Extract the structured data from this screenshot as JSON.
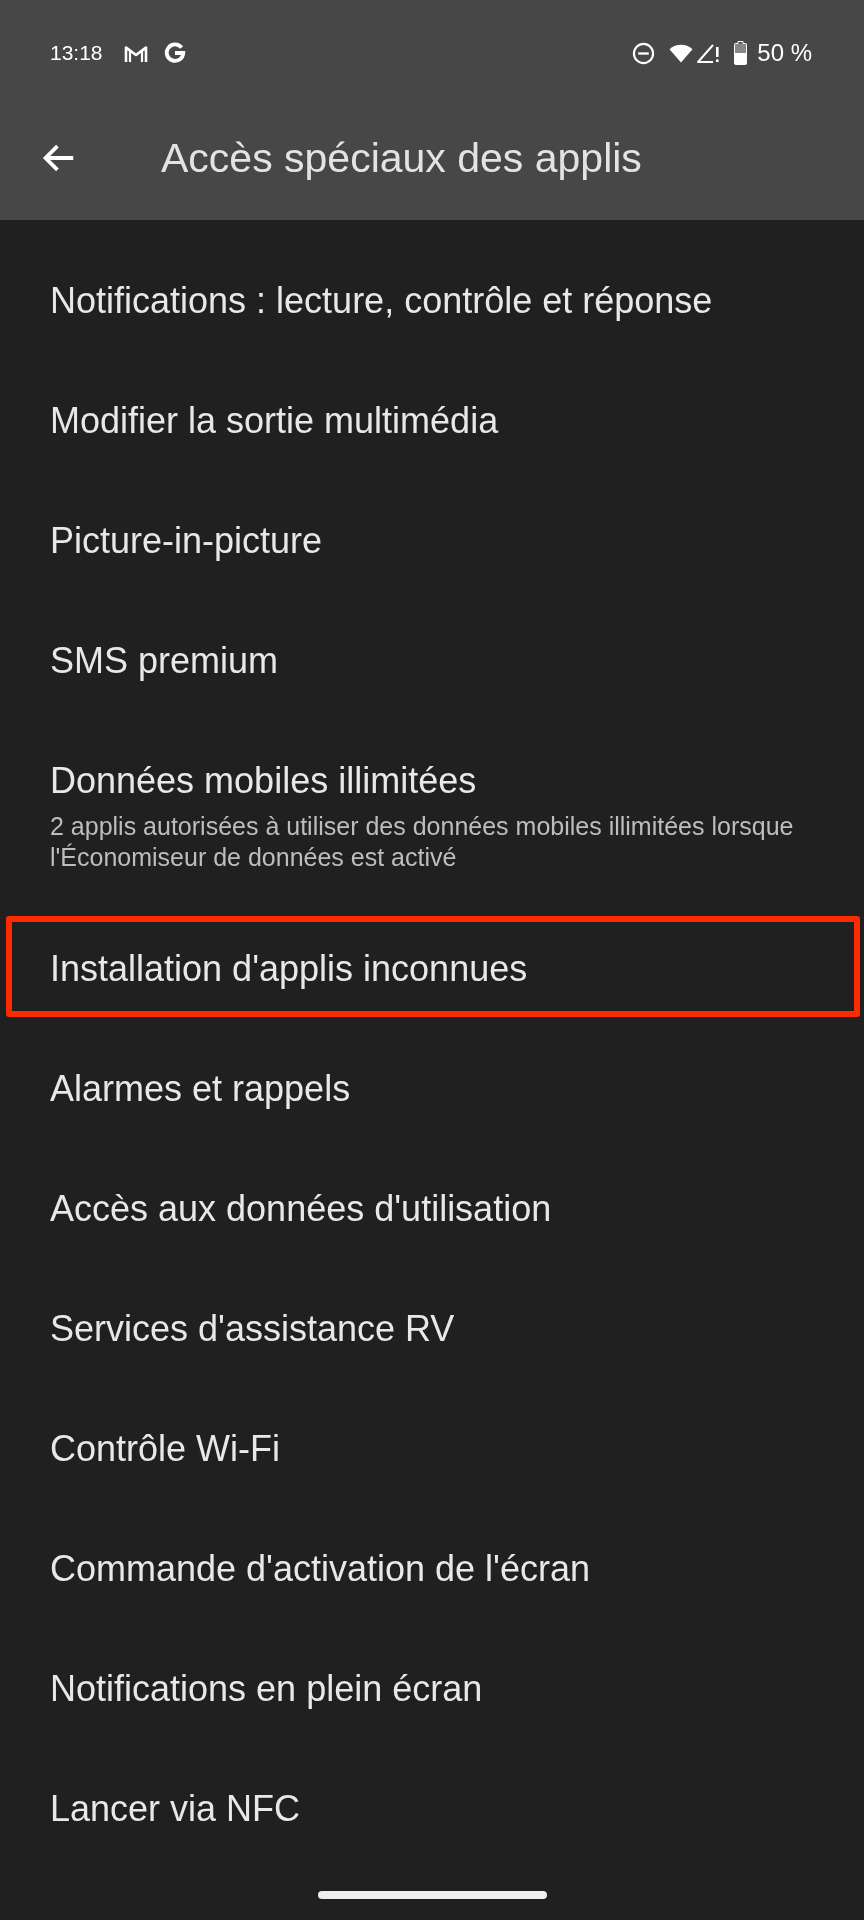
{
  "status_bar": {
    "time": "13:18",
    "battery_text": "50 %"
  },
  "header": {
    "title": "Accès spéciaux des applis"
  },
  "items": [
    {
      "title": "Notifications : lecture, contrôle et réponse",
      "highlighted": false
    },
    {
      "title": "Modifier la sortie multimédia",
      "highlighted": false
    },
    {
      "title": "Picture-in-picture",
      "highlighted": false
    },
    {
      "title": "SMS premium",
      "highlighted": false
    },
    {
      "title": "Données mobiles illimitées",
      "subtitle": "2 applis autorisées à utiliser des données mobiles illimitées lorsque l'Économiseur de données est activé",
      "highlighted": false
    },
    {
      "title": "Installation d'applis inconnues",
      "highlighted": true
    },
    {
      "title": "Alarmes et rappels",
      "highlighted": false
    },
    {
      "title": "Accès aux données d'utilisation",
      "highlighted": false
    },
    {
      "title": "Services d'assistance RV",
      "highlighted": false
    },
    {
      "title": "Contrôle Wi-Fi",
      "highlighted": false
    },
    {
      "title": "Commande d'activation de l'écran",
      "highlighted": false
    },
    {
      "title": "Notifications en plein écran",
      "highlighted": false
    },
    {
      "title": "Lancer via NFC",
      "highlighted": false
    }
  ]
}
